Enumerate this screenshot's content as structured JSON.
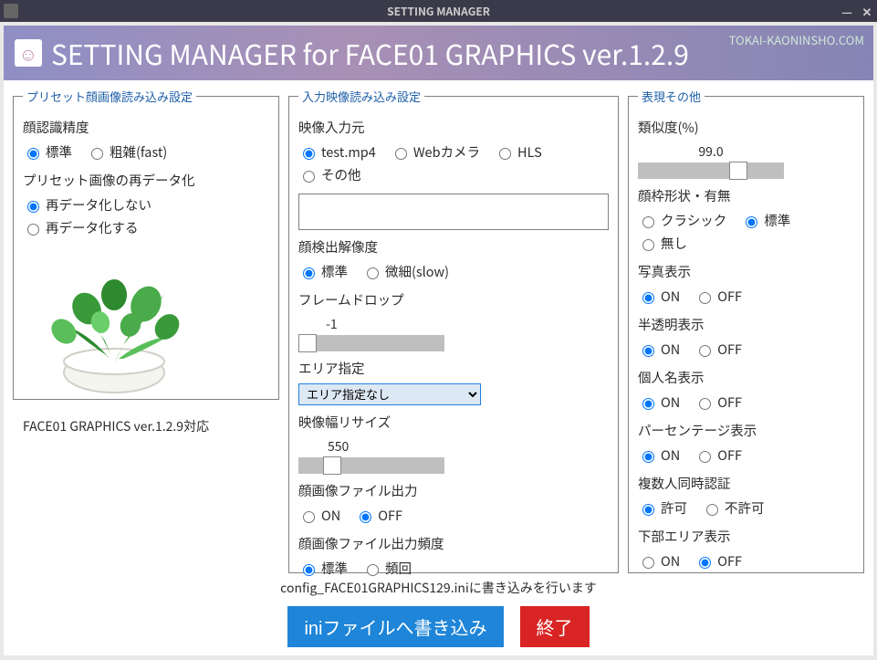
{
  "window": {
    "title": "SETTING MANAGER"
  },
  "header": {
    "title": "SETTING MANAGER for FACE01 GRAPHICS ver.1.2.9",
    "url": "TOKAI-KAONINSHO.COM"
  },
  "col1": {
    "legend": "プリセット顔画像読み込み設定",
    "accuracy_label": "顔認識精度",
    "accuracy_std": "標準",
    "accuracy_fast": "粗雑(fast)",
    "redigitize_label": "プリセット画像の再データ化",
    "redigitize_no": "再データ化しない",
    "redigitize_yes": "再データ化する",
    "caption": "FACE01 GRAPHICS ver.1.2.9対応"
  },
  "col2": {
    "legend": "入力映像読み込み設定",
    "source_label": "映像入力元",
    "source_test": "test.mp4",
    "source_webcam": "Webカメラ",
    "source_hls": "HLS",
    "source_other": "その他",
    "source_value": "",
    "detect_res_label": "顔検出解像度",
    "detect_std": "標準",
    "detect_slow": "微細(slow)",
    "framedrop_label": "フレームドロップ",
    "framedrop_value": "-1",
    "area_label": "エリア指定",
    "area_option": "エリア指定なし",
    "resize_label": "映像幅リサイズ",
    "resize_value": "550",
    "fileout_label": "顔画像ファイル出力",
    "on": "ON",
    "off": "OFF",
    "fileout_freq_label": "顔画像ファイル出力頻度",
    "freq_std": "標準",
    "freq_often": "頻回"
  },
  "col3": {
    "legend": "表現その他",
    "similarity_label": "類似度(%)",
    "similarity_value": "99.0",
    "frameshape_label": "顔枠形状・有無",
    "shape_classic": "クラシック",
    "shape_std": "標準",
    "shape_none": "無し",
    "photo_label": "写真表示",
    "translucent_label": "半透明表示",
    "name_label": "個人名表示",
    "percent_label": "パーセンテージ表示",
    "multi_label": "複数人同時認証",
    "multi_allow": "許可",
    "multi_deny": "不許可",
    "bottom_label": "下部エリア表示",
    "on": "ON",
    "off": "OFF"
  },
  "footer": {
    "message": "config_FACE01GRAPHICS129.iniに書き込みを行います",
    "write_button": "iniファイルへ書き込み",
    "exit_button": "終了"
  }
}
